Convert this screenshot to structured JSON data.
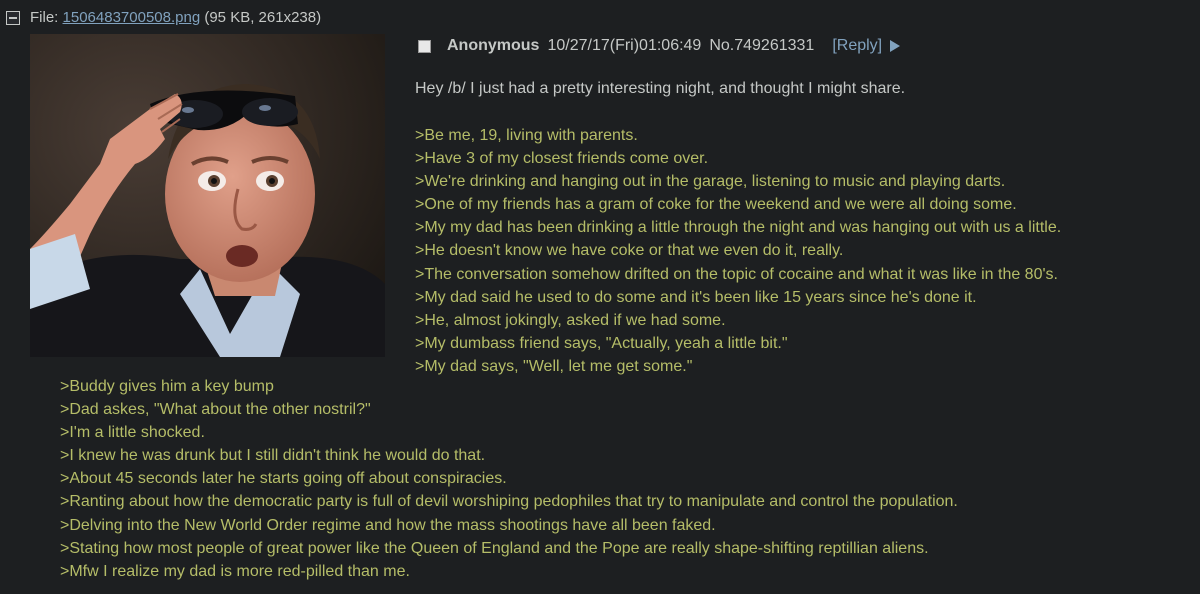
{
  "file": {
    "prefix": "File:",
    "filename": "1506483700508.png",
    "meta": "(95 KB, 261x238)"
  },
  "post": {
    "name": "Anonymous",
    "datetime": "10/27/17(Fri)01:06:49",
    "number": "No.749261331",
    "reply_label": "[Reply]",
    "intro": "Hey /b/ I just had a pretty interesting night, and thought I might share.",
    "greentext_top": [
      ">Be me, 19, living with parents.",
      ">Have 3 of my closest friends come over.",
      ">We're drinking and hanging out in the garage, listening to music and playing darts.",
      ">One of my friends has a gram of coke for the weekend and we were all doing some.",
      ">My my dad has been drinking a little through the night and was hanging out with us a little.",
      ">He doesn't know we have coke or that we even do it, really.",
      ">The conversation somehow drifted on the topic of cocaine and what it was like in the 80's.",
      ">My dad said he used to do some and it's been like 15 years since he's done it.",
      ">He, almost jokingly, asked if we had some.",
      ">My dumbass friend says, \"Actually, yeah a little bit.\"",
      ">My dad says, \"Well, let me get some.\""
    ],
    "greentext_bottom": [
      ">Buddy gives him a key bump",
      ">Dad askes, \"What about the other nostril?\"",
      ">I'm a little shocked.",
      ">I knew he was drunk but I still didn't think he would do that.",
      ">About 45 seconds later he starts going off about conspiracies.",
      ">Ranting about how the democratic party is full of devil worshiping pedophiles that try to manipulate and control the population.",
      ">Delving into the New World Order regime and how the mass shootings have all been faked.",
      ">Stating how most people of great power like the Queen of England and the Pope are really shape-shifting reptillian aliens.",
      ">Mfw I realize my dad is more red-pilled than me."
    ]
  },
  "colors": {
    "background": "#1d1f21",
    "text": "#c5c8c6",
    "link": "#81a2be",
    "greentext": "#b5bd68"
  }
}
